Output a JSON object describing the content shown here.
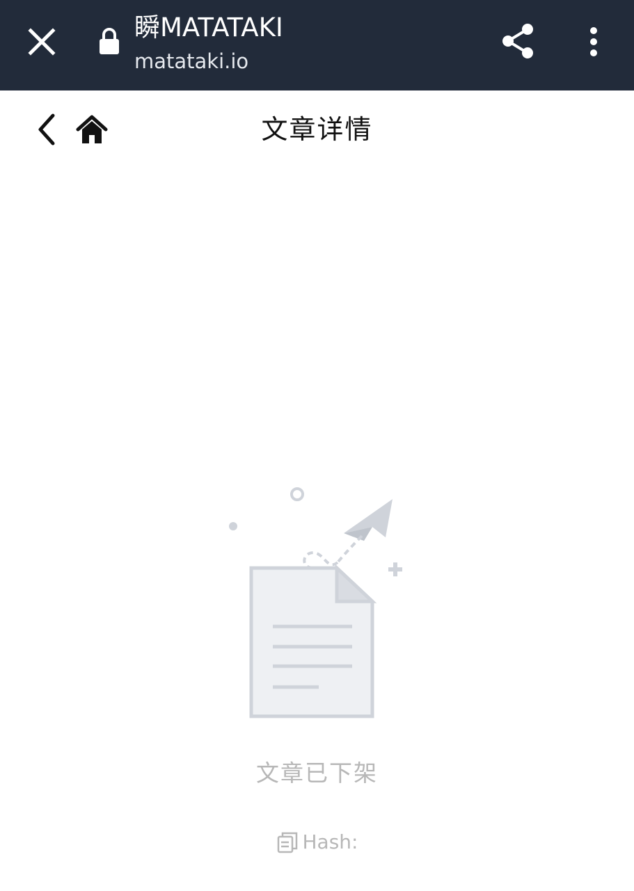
{
  "browser": {
    "title": "瞬MATATAKI",
    "url": "matataki.io",
    "icons": {
      "close": "close-icon",
      "lock": "lock-icon",
      "share": "share-icon",
      "menu": "more-vert-icon"
    },
    "bar_color": "#222b3a"
  },
  "nav": {
    "title": "文章详情",
    "icons": {
      "back": "chevron-left-icon",
      "home": "home-icon"
    }
  },
  "empty_state": {
    "illustration": "paper-plane-document-illustration",
    "message": "文章已下架"
  },
  "hash": {
    "icon": "copy-icon",
    "label": "Hash:"
  }
}
